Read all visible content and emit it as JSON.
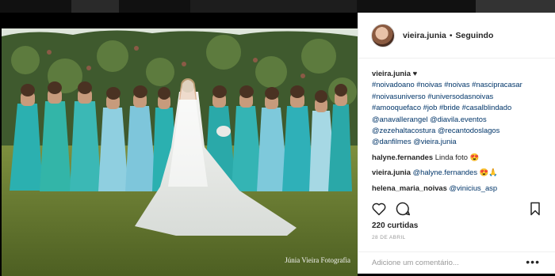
{
  "header": {
    "username": "vieira.junia",
    "separator": "•",
    "follow_status": "Seguindo"
  },
  "caption": {
    "username": "vieira.junia",
    "heart": "♥",
    "lines": [
      "#noivadoano #noivas #noivas #nascipracasar",
      "#noivasuniverso #universodasnoivas",
      "#amooquefaco #job #bride #casalblindado",
      "@anavallerangel @diavila.eventos",
      "@zezehaltacostura @recantodoslagos",
      "@danfilmes @vieira.junia"
    ]
  },
  "comments": [
    {
      "user": "halyne.fernandes",
      "text": "Linda foto 😍"
    },
    {
      "user": "vieira.junia",
      "text": "@halyne.fernandes 😍🙏"
    },
    {
      "user": "helena_maria_noivas",
      "text": "@vinicius_asp"
    }
  ],
  "icons": {
    "like": "heart-icon",
    "comment": "comment-icon",
    "save": "bookmark-icon"
  },
  "likes_text": "220 curtidas",
  "date_text": "28 DE ABRIL",
  "add_comment_placeholder": "Adicione um comentário...",
  "more_options": "•••",
  "photo": {
    "watermark": "Júnia Vieira Fotografia"
  },
  "colors": {
    "link": "#003569",
    "dress_teal": "#2fb3b3",
    "dress_light": "#8fcfe0"
  }
}
